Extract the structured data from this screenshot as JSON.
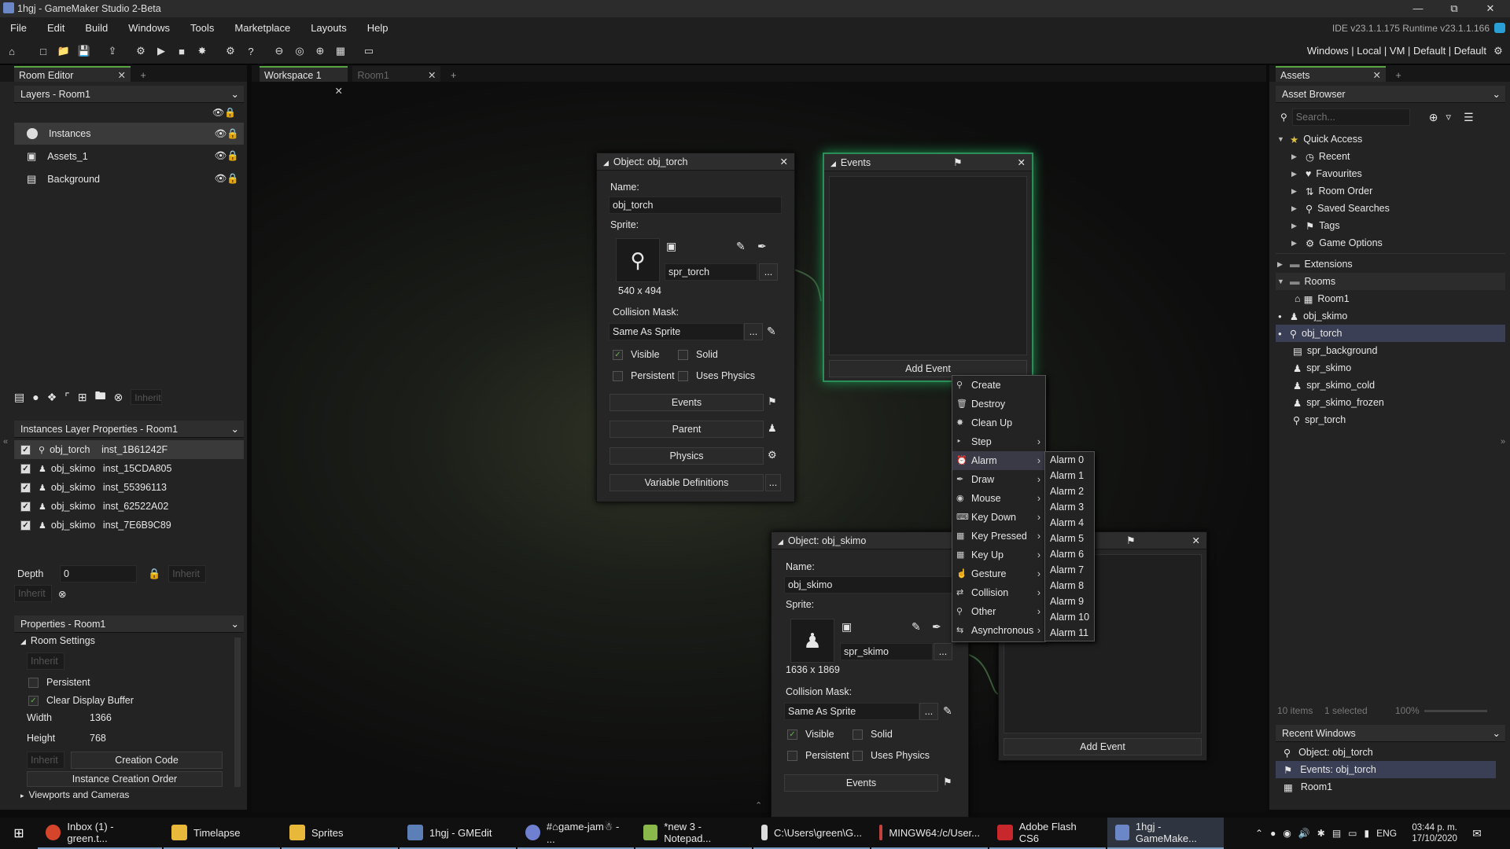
{
  "window": {
    "title": "1hgj - GameMaker Studio 2-Beta",
    "version": "IDE v23.1.1.175  Runtime v23.1.1.166"
  },
  "menu": [
    "File",
    "Edit",
    "Build",
    "Windows",
    "Tools",
    "Marketplace",
    "Layouts",
    "Help"
  ],
  "targets": "Windows  |  Local  |  VM  |  Default  |  Default",
  "left": {
    "tab": "Room Editor",
    "layers_title": "Layers - Room1",
    "layers": [
      "Instances",
      "Assets_1",
      "Background"
    ],
    "inherit": "Inherit",
    "instances_title": "Instances Layer Properties - Room1",
    "instances": [
      {
        "obj": "obj_torch",
        "id": "inst_1B61242F"
      },
      {
        "obj": "obj_skimo",
        "id": "inst_15CDA805"
      },
      {
        "obj": "obj_skimo",
        "id": "inst_55396113"
      },
      {
        "obj": "obj_skimo",
        "id": "inst_62522A02"
      },
      {
        "obj": "obj_skimo",
        "id": "inst_7E6B9C89"
      }
    ],
    "depth_label": "Depth",
    "depth_value": "0",
    "props_title": "Properties - Room1",
    "room_settings": "Room Settings",
    "persistent": "Persistent",
    "clear_display": "Clear Display Buffer",
    "width_label": "Width",
    "width_value": "1366",
    "height_label": "Height",
    "height_value": "768",
    "creation_code": "Creation Code",
    "instance_order": "Instance Creation Order",
    "viewports": "Viewports and Cameras"
  },
  "workspace": {
    "tabs": [
      "Workspace 1",
      "Room1"
    ]
  },
  "obj_torch": {
    "title": "Object: obj_torch",
    "name_label": "Name:",
    "name": "obj_torch",
    "sprite_label": "Sprite:",
    "sprite": "spr_torch",
    "size": "540 x 494",
    "mask_label": "Collision Mask:",
    "mask": "Same As Sprite",
    "visible": "Visible",
    "solid": "Solid",
    "persistent": "Persistent",
    "uses_physics": "Uses Physics",
    "events": "Events",
    "parent": "Parent",
    "physics": "Physics",
    "variables": "Variable Definitions",
    "dots": "..."
  },
  "events_win": {
    "title": "Events",
    "add_event": "Add Event"
  },
  "obj_skimo": {
    "title": "Object: obj_skimo",
    "name_label": "Name:",
    "name": "obj_skimo",
    "sprite_label": "Sprite:",
    "sprite": "spr_skimo",
    "size": "1636 x 1869",
    "mask_label": "Collision Mask:",
    "mask": "Same As Sprite",
    "visible": "Visible",
    "solid": "Solid",
    "persistent": "Persistent",
    "uses_physics": "Uses Physics",
    "events": "Events"
  },
  "events_win2": {
    "add_event": "Add Event"
  },
  "ctx_menu": [
    "Create",
    "Destroy",
    "Clean Up",
    "Step",
    "Alarm",
    "Draw",
    "Mouse",
    "Key Down",
    "Key Pressed",
    "Key Up",
    "Gesture",
    "Collision",
    "Other",
    "Asynchronous"
  ],
  "alarm_menu": [
    "Alarm 0",
    "Alarm 1",
    "Alarm 2",
    "Alarm 3",
    "Alarm 4",
    "Alarm 5",
    "Alarm 6",
    "Alarm 7",
    "Alarm 8",
    "Alarm 9",
    "Alarm 10",
    "Alarm 11"
  ],
  "right": {
    "tab": "Assets",
    "browser": "Asset Browser",
    "search_placeholder": "Search...",
    "quick_access": "Quick Access",
    "quick_items": [
      "Recent",
      "Favourites",
      "Room Order",
      "Saved Searches",
      "Tags",
      "Game Options"
    ],
    "extensions": "Extensions",
    "rooms": "Rooms",
    "room1": "Room1",
    "assets": [
      "obj_skimo",
      "obj_torch",
      "spr_background",
      "spr_skimo",
      "spr_skimo_cold",
      "spr_skimo_frozen",
      "spr_torch"
    ],
    "status_items": "10 items",
    "status_selected": "1 selected",
    "zoom": "100%",
    "recent_title": "Recent Windows",
    "recent": [
      "Object: obj_torch",
      "Events: obj_torch",
      "Room1"
    ]
  },
  "taskbar": {
    "items": [
      "Inbox (1) - green.t...",
      "Timelapse",
      "Sprites",
      "1hgj - GMEdit",
      "#⌂game-jam☃ - ...",
      "*new 3 - Notepad...",
      "C:\\Users\\green\\G...",
      "MINGW64:/c/User...",
      "Adobe Flash CS6",
      "1hgj - GameMake..."
    ],
    "lang": "ENG",
    "time": "03:44 p. m.",
    "date": "17/10/2020"
  },
  "colors": {
    "accent_green": "#2d8d58",
    "selection": "#3a3f55"
  }
}
